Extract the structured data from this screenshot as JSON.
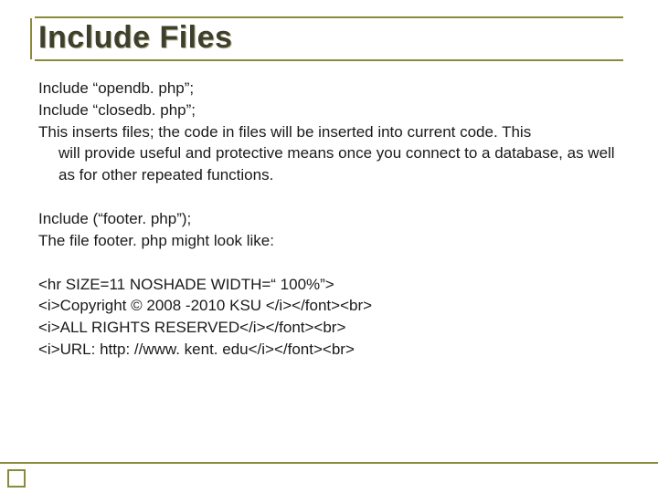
{
  "title": "Include Files",
  "block1": {
    "line1": "Include “opendb. php”;",
    "line2": "Include “closedb. php”;",
    "desc_lead": "This inserts files; the code in files will be inserted into current code. This",
    "desc_cont": "will provide useful and protective means once you connect to a database, as well as for other repeated functions."
  },
  "block2": {
    "line1": "Include (“footer. php”);",
    "line2": "The file footer. php might look like:"
  },
  "block3": {
    "line1": "<hr SIZE=11 NOSHADE WIDTH=“ 100%”>",
    "line2": "<i>Copyright © 2008 -2010 KSU </i></font><br>",
    "line3": "<i>ALL RIGHTS RESERVED</i></font><br>",
    "line4": "<i>URL: http: //www. kent. edu</i></font><br>"
  }
}
